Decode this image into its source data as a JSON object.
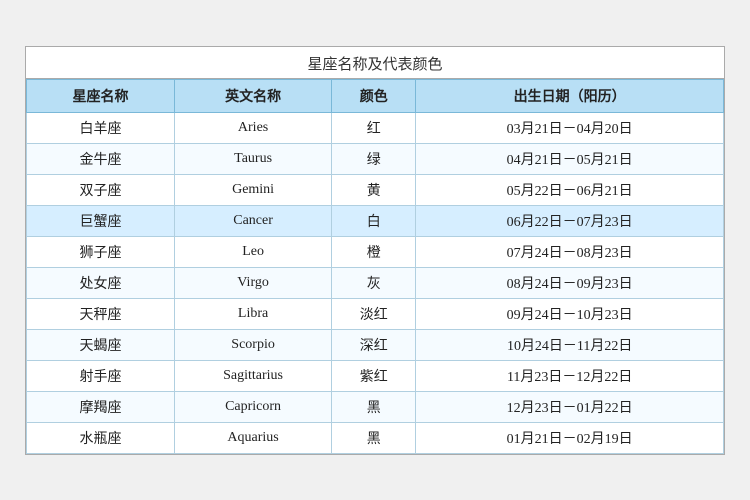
{
  "title": "星座名称及代表颜色",
  "columns": [
    "星座名称",
    "英文名称",
    "颜色",
    "出生日期（阳历）"
  ],
  "rows": [
    {
      "zh": "白羊座",
      "en": "Aries",
      "color": "红",
      "date": "03月21日－04月20日"
    },
    {
      "zh": "金牛座",
      "en": "Taurus",
      "color": "绿",
      "date": "04月21日－05月21日"
    },
    {
      "zh": "双子座",
      "en": "Gemini",
      "color": "黄",
      "date": "05月22日－06月21日"
    },
    {
      "zh": "巨蟹座",
      "en": "Cancer",
      "color": "白",
      "date": "06月22日－07月23日"
    },
    {
      "zh": "狮子座",
      "en": "Leo",
      "color": "橙",
      "date": "07月24日－08月23日"
    },
    {
      "zh": "处女座",
      "en": "Virgo",
      "color": "灰",
      "date": "08月24日－09月23日"
    },
    {
      "zh": "天秤座",
      "en": "Libra",
      "color": "淡红",
      "date": "09月24日－10月23日"
    },
    {
      "zh": "天蝎座",
      "en": "Scorpio",
      "color": "深红",
      "date": "10月24日－11月22日"
    },
    {
      "zh": "射手座",
      "en": "Sagittarius",
      "color": "紫红",
      "date": "11月23日－12月22日"
    },
    {
      "zh": "摩羯座",
      "en": "Capricorn",
      "color": "黑",
      "date": "12月23日－01月22日"
    },
    {
      "zh": "水瓶座",
      "en": "Aquarius",
      "color": "黑",
      "date": "01月21日－02月19日"
    }
  ],
  "highlighted_row": 3
}
